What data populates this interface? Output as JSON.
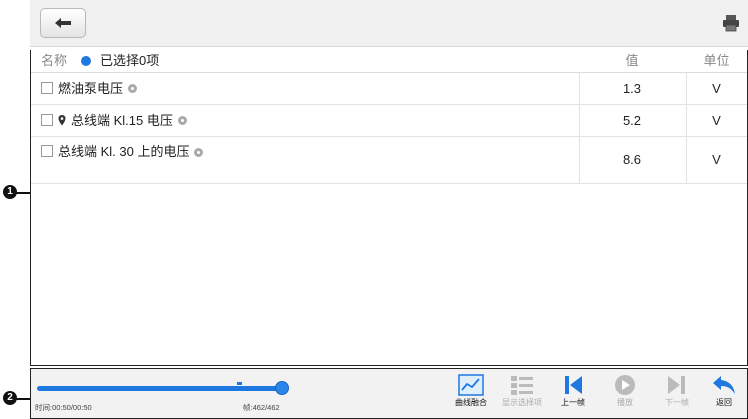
{
  "callouts": [
    "1",
    "2"
  ],
  "table": {
    "header": {
      "name": "名称",
      "selected": "已选择0项",
      "value": "值",
      "unit": "单位"
    },
    "rows": [
      {
        "name": "燃油泵电压",
        "pin": false,
        "value": "1.3",
        "unit": "V"
      },
      {
        "name": "总线端 Kl.15 电压",
        "pin": true,
        "value": "5.2",
        "unit": "V"
      },
      {
        "name": "总线端 Kl. 30 上的电压",
        "pin": false,
        "value": "8.6",
        "unit": "V"
      }
    ]
  },
  "playback": {
    "progress_fraction": 1.0,
    "time": "时间:00:50/00:50",
    "frame": "帧:462/462"
  },
  "toolbar": {
    "merge": "曲线融合",
    "show_selected": "显示选择项",
    "prev": "上一帧",
    "play": "播放",
    "next": "下一帧",
    "back": "返回"
  },
  "colors": {
    "accent": "#1e78e0",
    "toolbar_bg": "#f2f2f2",
    "topbar_bg": "#f0f0f0"
  }
}
